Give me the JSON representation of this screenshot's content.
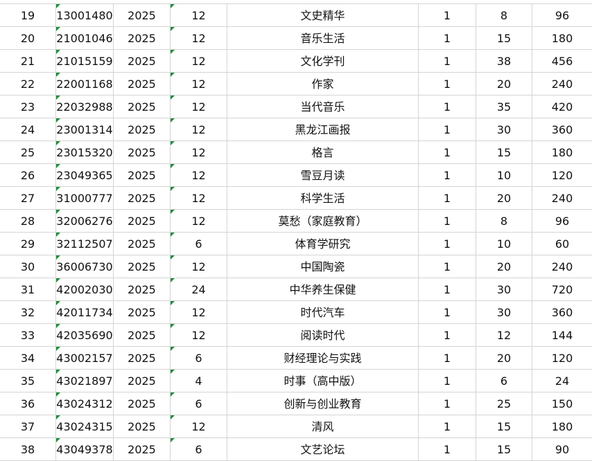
{
  "rows": [
    {
      "no": "19",
      "code": "13001480",
      "year": "2025",
      "issues": "12",
      "title": "文史精华",
      "qty": "1",
      "price": "8",
      "total": "96"
    },
    {
      "no": "20",
      "code": "21001046",
      "year": "2025",
      "issues": "12",
      "title": "音乐生活",
      "qty": "1",
      "price": "15",
      "total": "180"
    },
    {
      "no": "21",
      "code": "21015159",
      "year": "2025",
      "issues": "12",
      "title": "文化学刊",
      "qty": "1",
      "price": "38",
      "total": "456"
    },
    {
      "no": "22",
      "code": "22001168",
      "year": "2025",
      "issues": "12",
      "title": "作家",
      "qty": "1",
      "price": "20",
      "total": "240"
    },
    {
      "no": "23",
      "code": "22032988",
      "year": "2025",
      "issues": "12",
      "title": "当代音乐",
      "qty": "1",
      "price": "35",
      "total": "420"
    },
    {
      "no": "24",
      "code": "23001314",
      "year": "2025",
      "issues": "12",
      "title": "黑龙江画报",
      "qty": "1",
      "price": "30",
      "total": "360"
    },
    {
      "no": "25",
      "code": "23015320",
      "year": "2025",
      "issues": "12",
      "title": "格言",
      "qty": "1",
      "price": "15",
      "total": "180"
    },
    {
      "no": "26",
      "code": "23049365",
      "year": "2025",
      "issues": "12",
      "title": "雪豆月读",
      "qty": "1",
      "price": "10",
      "total": "120"
    },
    {
      "no": "27",
      "code": "31000777",
      "year": "2025",
      "issues": "12",
      "title": "科学生活",
      "qty": "1",
      "price": "20",
      "total": "240"
    },
    {
      "no": "28",
      "code": "32006276",
      "year": "2025",
      "issues": "12",
      "title": "莫愁（家庭教育）",
      "qty": "1",
      "price": "8",
      "total": "96"
    },
    {
      "no": "29",
      "code": "32112507",
      "year": "2025",
      "issues": "6",
      "title": "体育学研究",
      "qty": "1",
      "price": "10",
      "total": "60"
    },
    {
      "no": "30",
      "code": "36006730",
      "year": "2025",
      "issues": "12",
      "title": "中国陶瓷",
      "qty": "1",
      "price": "20",
      "total": "240"
    },
    {
      "no": "31",
      "code": "42002030",
      "year": "2025",
      "issues": "24",
      "title": "中华养生保健",
      "qty": "1",
      "price": "30",
      "total": "720"
    },
    {
      "no": "32",
      "code": "42011734",
      "year": "2025",
      "issues": "12",
      "title": "时代汽车",
      "qty": "1",
      "price": "30",
      "total": "360"
    },
    {
      "no": "33",
      "code": "42035690",
      "year": "2025",
      "issues": "12",
      "title": "阅读时代",
      "qty": "1",
      "price": "12",
      "total": "144"
    },
    {
      "no": "34",
      "code": "43002157",
      "year": "2025",
      "issues": "6",
      "title": "财经理论与实践",
      "qty": "1",
      "price": "20",
      "total": "120"
    },
    {
      "no": "35",
      "code": "43021897",
      "year": "2025",
      "issues": "4",
      "title": "时事（高中版）",
      "qty": "1",
      "price": "6",
      "total": "24"
    },
    {
      "no": "36",
      "code": "43024312",
      "year": "2025",
      "issues": "6",
      "title": "创新与创业教育",
      "qty": "1",
      "price": "25",
      "total": "150"
    },
    {
      "no": "37",
      "code": "43024315",
      "year": "2025",
      "issues": "12",
      "title": "清风",
      "qty": "1",
      "price": "15",
      "total": "180"
    },
    {
      "no": "38",
      "code": "43049378",
      "year": "2025",
      "issues": "6",
      "title": "文艺论坛",
      "qty": "1",
      "price": "15",
      "total": "90"
    }
  ],
  "colors": {
    "grid": "#d4d4d4",
    "text": "#111111",
    "text_marker": "#1e8f3a"
  }
}
